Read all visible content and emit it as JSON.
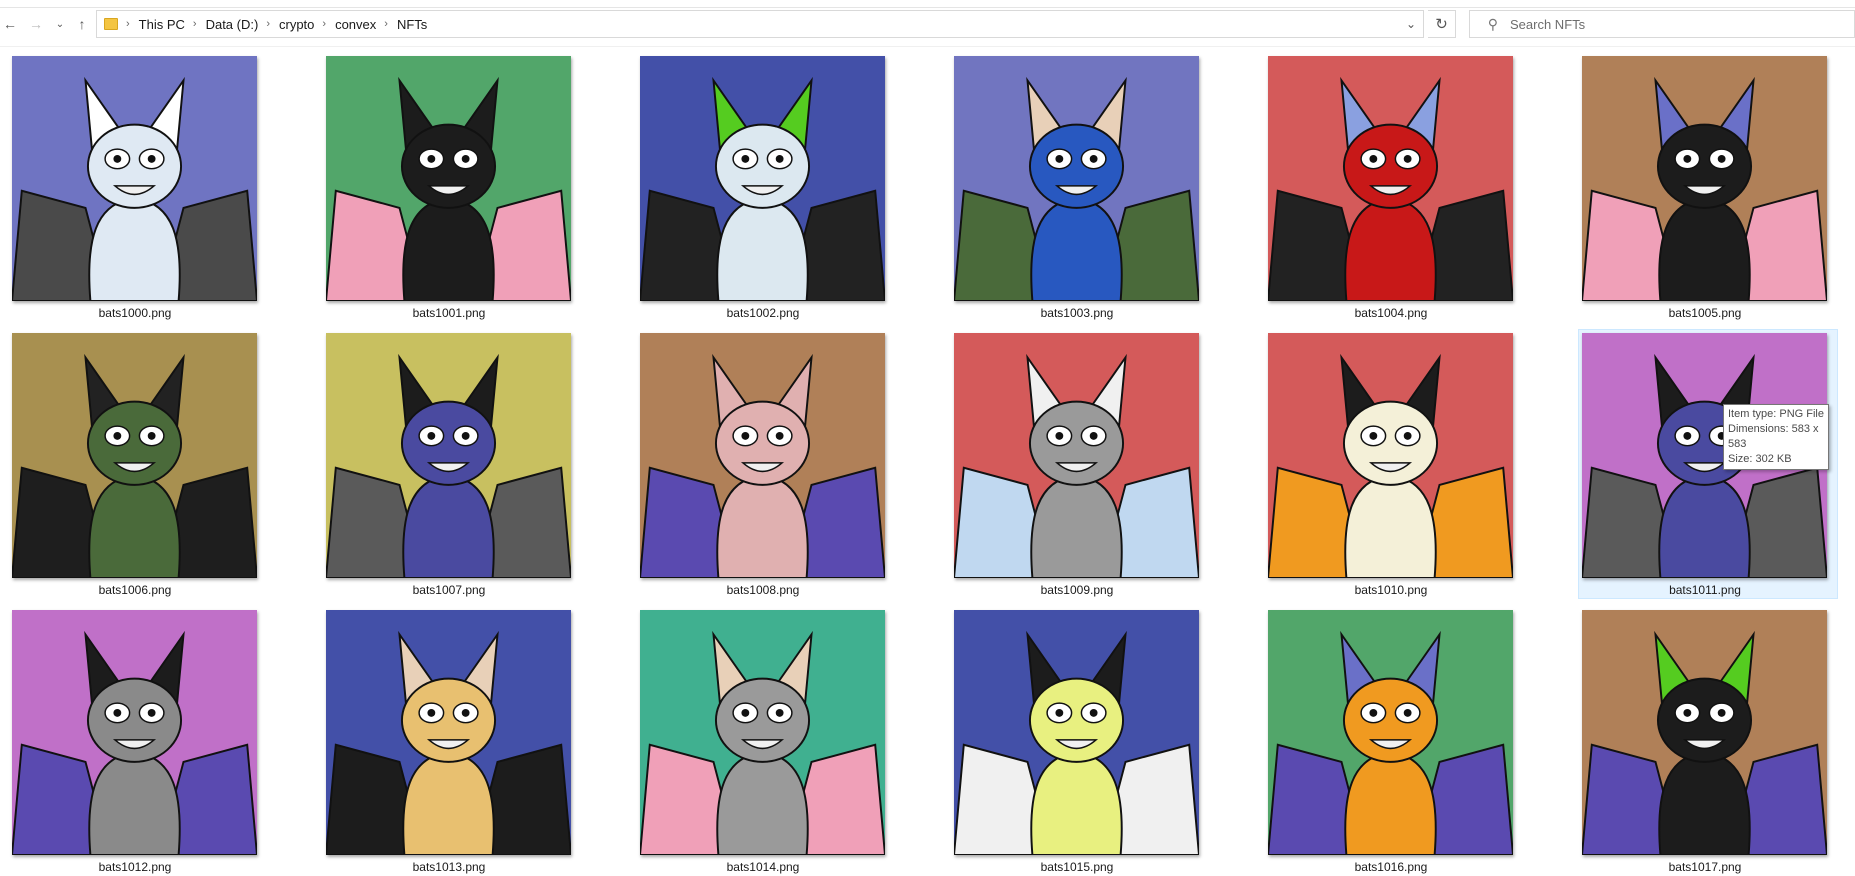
{
  "window": {
    "breadcrumb": [
      "This PC",
      "Data (D:)",
      "crypto",
      "convex",
      "NFTs"
    ],
    "search_placeholder": "Search NFTs"
  },
  "nav": {
    "back_icon": "arrow-left-icon",
    "forward_icon": "arrow-right-icon",
    "recent_icon": "chevron-down-icon",
    "up_icon": "arrow-up-icon",
    "refresh_icon": "refresh-icon"
  },
  "files": [
    {
      "name": "bats1000.png",
      "bg": "#6f74c2",
      "body": "#dfe9f3",
      "ear": "#ffffff",
      "wing": "#4a4a4a"
    },
    {
      "name": "bats1001.png",
      "bg": "#52a66a",
      "body": "#1c1c1c",
      "ear": "#1c1c1c",
      "wing": "#f0a0b8"
    },
    {
      "name": "bats1002.png",
      "bg": "#4350a8",
      "body": "#dce8f0",
      "ear": "#55cc20",
      "wing": "#222222"
    },
    {
      "name": "bats1003.png",
      "bg": "#7175c0",
      "body": "#2858c0",
      "ear": "#e8d0b8",
      "wing": "#4a6a3a"
    },
    {
      "name": "bats1004.png",
      "bg": "#d45a5a",
      "body": "#c81818",
      "ear": "#8aa0e0",
      "wing": "#222222"
    },
    {
      "name": "bats1005.png",
      "bg": "#b08058",
      "body": "#1c1c1c",
      "ear": "#6a70c8",
      "wing": "#f0a0b8"
    },
    {
      "name": "bats1006.png",
      "bg": "#a89050",
      "body": "#4a6a3a",
      "ear": "#222222",
      "wing": "#1e1e1e"
    },
    {
      "name": "bats1007.png",
      "bg": "#c8c060",
      "body": "#4a4aa0",
      "ear": "#1c1c1c",
      "wing": "#5a5a5a"
    },
    {
      "name": "bats1008.png",
      "bg": "#b08058",
      "body": "#e0b0b0",
      "ear": "#e0b0b0",
      "wing": "#5a4ab0"
    },
    {
      "name": "bats1009.png",
      "bg": "#d45a5a",
      "body": "#9a9a9a",
      "ear": "#f0f0f0",
      "wing": "#c0d8f0"
    },
    {
      "name": "bats1010.png",
      "bg": "#d45a5a",
      "body": "#f4f0d8",
      "ear": "#1c1c1c",
      "wing": "#f09a20"
    },
    {
      "name": "bats1011.png",
      "bg": "#c070c8",
      "body": "#4a4aa0",
      "ear": "#1c1c1c",
      "wing": "#5a5a5a"
    },
    {
      "name": "bats1012.png",
      "bg": "#c070c8",
      "body": "#8a8a8a",
      "ear": "#1c1c1c",
      "wing": "#5a4ab0"
    },
    {
      "name": "bats1013.png",
      "bg": "#4350a8",
      "body": "#e8c070",
      "ear": "#e8d0b8",
      "wing": "#1c1c1c"
    },
    {
      "name": "bats1014.png",
      "bg": "#40b090",
      "body": "#9a9a9a",
      "ear": "#e8d0b8",
      "wing": "#f0a0b8"
    },
    {
      "name": "bats1015.png",
      "bg": "#4350a8",
      "body": "#e8f080",
      "ear": "#1c1c1c",
      "wing": "#f0f0f0"
    },
    {
      "name": "bats1016.png",
      "bg": "#52a66a",
      "body": "#f09a20",
      "ear": "#6a70c8",
      "wing": "#5a4ab0"
    },
    {
      "name": "bats1017.png",
      "bg": "#b08058",
      "body": "#1c1c1c",
      "ear": "#55cc20",
      "wing": "#5a4ab0"
    }
  ],
  "tooltip": {
    "type": "Item type: PNG File",
    "dimensions": "Dimensions: 583 x 583",
    "size": "Size: 302 KB"
  }
}
